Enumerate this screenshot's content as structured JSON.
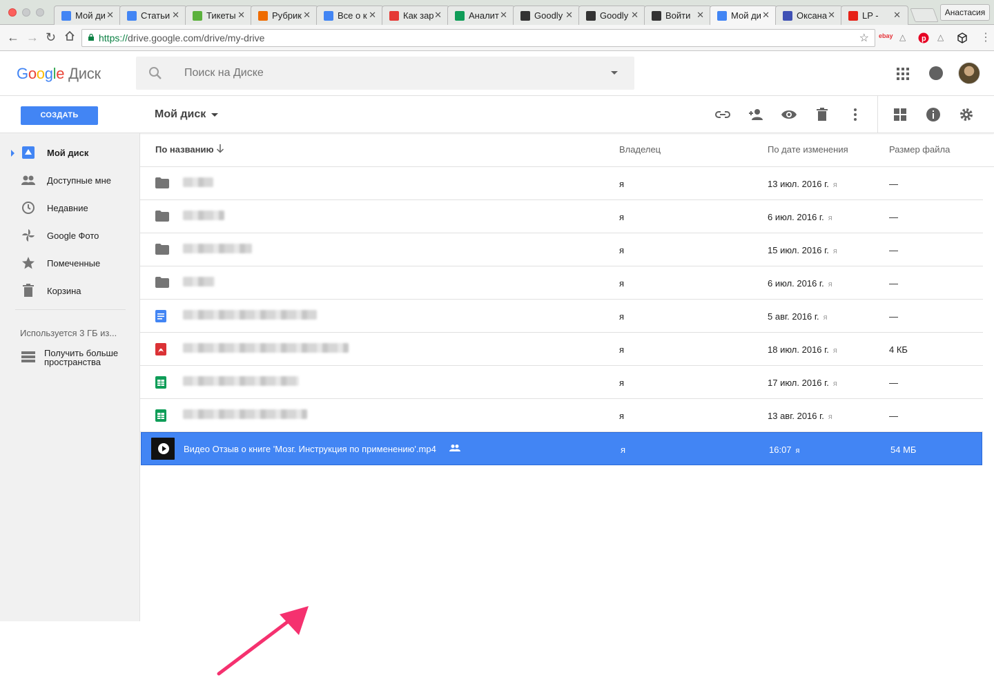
{
  "browser": {
    "tabs": [
      {
        "label": "Мой ди",
        "icon": "google-drive-icon",
        "color": "#4285f4"
      },
      {
        "label": "Статьи",
        "icon": "google-docs-icon",
        "color": "#4285f4"
      },
      {
        "label": "Тикеты",
        "icon": "helpdesk-icon",
        "color": "#5bb13c"
      },
      {
        "label": "Рубрик",
        "icon": "bar-chart-icon",
        "color": "#ef6c00"
      },
      {
        "label": "Все о к",
        "icon": "bar-chart-icon",
        "color": "#4285f4"
      },
      {
        "label": "Как зар",
        "icon": "video-icon",
        "color": "#e53935"
      },
      {
        "label": "Аналит",
        "icon": "google-sheets-icon",
        "color": "#0f9d58"
      },
      {
        "label": "Goodly",
        "icon": "globe-icon",
        "color": "#333333"
      },
      {
        "label": "Goodly",
        "icon": "globe-icon",
        "color": "#333333"
      },
      {
        "label": "Войти",
        "icon": "globe-icon",
        "color": "#333333"
      },
      {
        "label": "Мой ди",
        "icon": "google-drive-icon",
        "color": "#4285f4",
        "active": true
      },
      {
        "label": "Оксана",
        "icon": "pause-icon",
        "color": "#3f51b5"
      },
      {
        "label": "LP -",
        "icon": "youtube-icon",
        "color": "#e62117"
      }
    ],
    "profile_name": "Анастасия",
    "url_scheme": "https://",
    "url_host": "drive.google.com",
    "url_path": "/drive/my-drive",
    "ext_ebay": "ebay"
  },
  "drive": {
    "logo_google": [
      "G",
      "o",
      "o",
      "g",
      "l",
      "e"
    ],
    "logo_product": "Диск",
    "search_placeholder": "Поиск на Диске",
    "create_label": "СОЗДАТЬ",
    "breadcrumb": "Мой диск",
    "sidebar": {
      "items": [
        {
          "label": "Мой диск",
          "icon": "my-drive-icon",
          "active": true
        },
        {
          "label": "Доступные мне",
          "icon": "shared-people-icon"
        },
        {
          "label": "Недавние",
          "icon": "clock-icon"
        },
        {
          "label": "Google Фото",
          "icon": "google-photos-icon"
        },
        {
          "label": "Помеченные",
          "icon": "star-icon"
        },
        {
          "label": "Корзина",
          "icon": "trash-icon"
        }
      ],
      "quota": "Используется 3 ГБ из...",
      "get_more": "Получить больше пространства"
    },
    "columns": {
      "name": "По названию",
      "owner": "Владелец",
      "modified": "По дате изменения",
      "size": "Размер файла"
    },
    "files": [
      {
        "type": "folder",
        "owner": "я",
        "date": "13 июл. 2016 г.",
        "by": "я",
        "size": "—"
      },
      {
        "type": "folder",
        "owner": "я",
        "date": "6 июл. 2016 г.",
        "by": "я",
        "size": "—"
      },
      {
        "type": "folder",
        "owner": "я",
        "date": "15 июл. 2016 г.",
        "by": "я",
        "size": "—"
      },
      {
        "type": "folder",
        "owner": "я",
        "date": "6 июл. 2016 г.",
        "by": "я",
        "size": "—"
      },
      {
        "type": "doc",
        "owner": "я",
        "date": "5 авг. 2016 г.",
        "by": "я",
        "size": "—"
      },
      {
        "type": "pdf",
        "owner": "я",
        "date": "18 июл. 2016 г.",
        "by": "я",
        "size": "4 КБ"
      },
      {
        "type": "sheet",
        "owner": "я",
        "date": "17 июл. 2016 г.",
        "by": "я",
        "size": "—"
      },
      {
        "type": "sheet",
        "owner": "я",
        "date": "13 авг. 2016 г.",
        "by": "я",
        "size": "—"
      }
    ],
    "selected_file": {
      "name": "Видео Отзыв о книге 'Мозг. Инструкция по применению'.mp4",
      "owner": "я",
      "date": "16:07",
      "by": "я",
      "size": "54 МБ"
    },
    "colors": {
      "accent": "#4285f4",
      "annotation_arrow": "#f5316f",
      "folder": "#757575",
      "doc": "#4285f4",
      "pdf": "#db3236",
      "sheet": "#0f9d58"
    }
  }
}
